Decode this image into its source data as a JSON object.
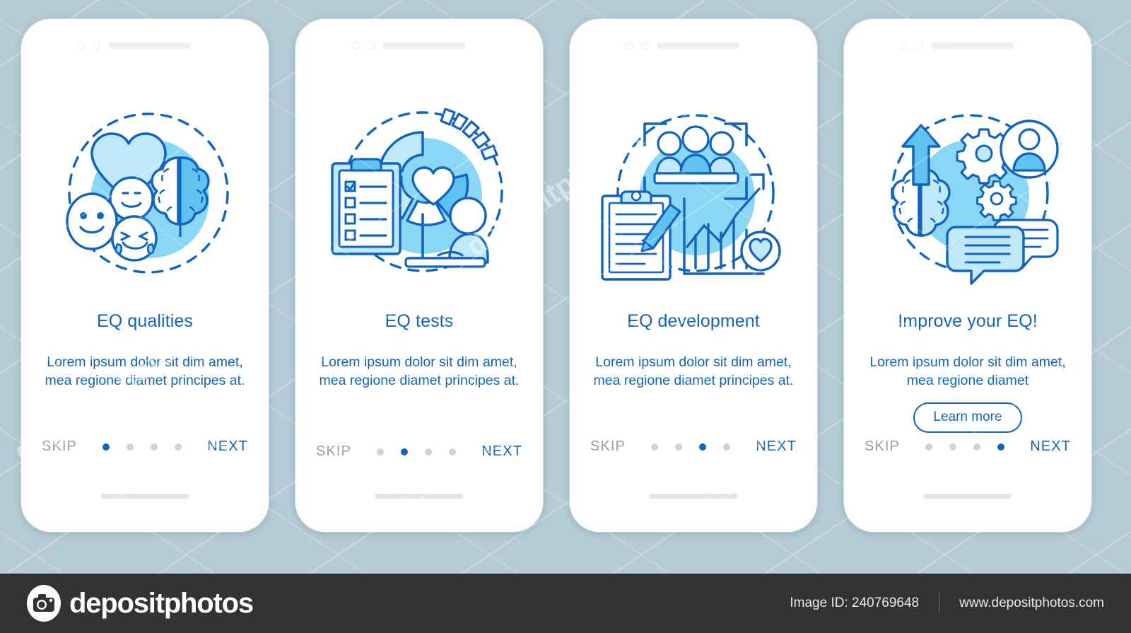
{
  "canvas": {
    "background_color": "#b5cbd6",
    "accent_blue": "#1164bd",
    "icon_line_blue": "#1263c0",
    "icon_fill_light": "#bfe9fb",
    "icon_fill_mid": "#5fc2ef",
    "icon_circle_bg": "#8ad7f5",
    "muted_gray": "#9a9da1",
    "dot_inactive": "#cfd2d6"
  },
  "screens": [
    {
      "title": "EQ qualities",
      "description": "Lorem ipsum dolor sit dim amet, mea regione diamet principes at.",
      "illustration": "heart-brain-emoji-faces",
      "skip_label": "SKIP",
      "next_label": "NEXT",
      "dots": 4,
      "active_dot": 1,
      "cta": null
    },
    {
      "title": "EQ tests",
      "description": "Lorem ipsum dolor sit dim amet, mea regione diamet principes at.",
      "illustration": "checklist-donut-heart-person-computer",
      "skip_label": "SKIP",
      "next_label": "NEXT",
      "dots": 4,
      "active_dot": 2,
      "cta": null
    },
    {
      "title": "EQ development",
      "description": "Lorem ipsum dolor sit dim amet, mea regione diamet principes at.",
      "illustration": "team-clipboard-growth-chart-heart",
      "skip_label": "SKIP",
      "next_label": "NEXT",
      "dots": 4,
      "active_dot": 3,
      "cta": null
    },
    {
      "title": "Improve your EQ!",
      "description": "Lorem ipsum dolor sit dim amet, mea regione diamet",
      "illustration": "brain-arrow-gears-avatar-chat",
      "skip_label": "SKIP",
      "next_label": "NEXT",
      "dots": 4,
      "active_dot": 4,
      "cta": "Learn more"
    }
  ],
  "footer": {
    "brand": "depositphotos",
    "image_id_label": "Image ID: 240769648",
    "website": "www.depositphotos.com"
  },
  "watermark": {
    "word": "depositphotos"
  }
}
